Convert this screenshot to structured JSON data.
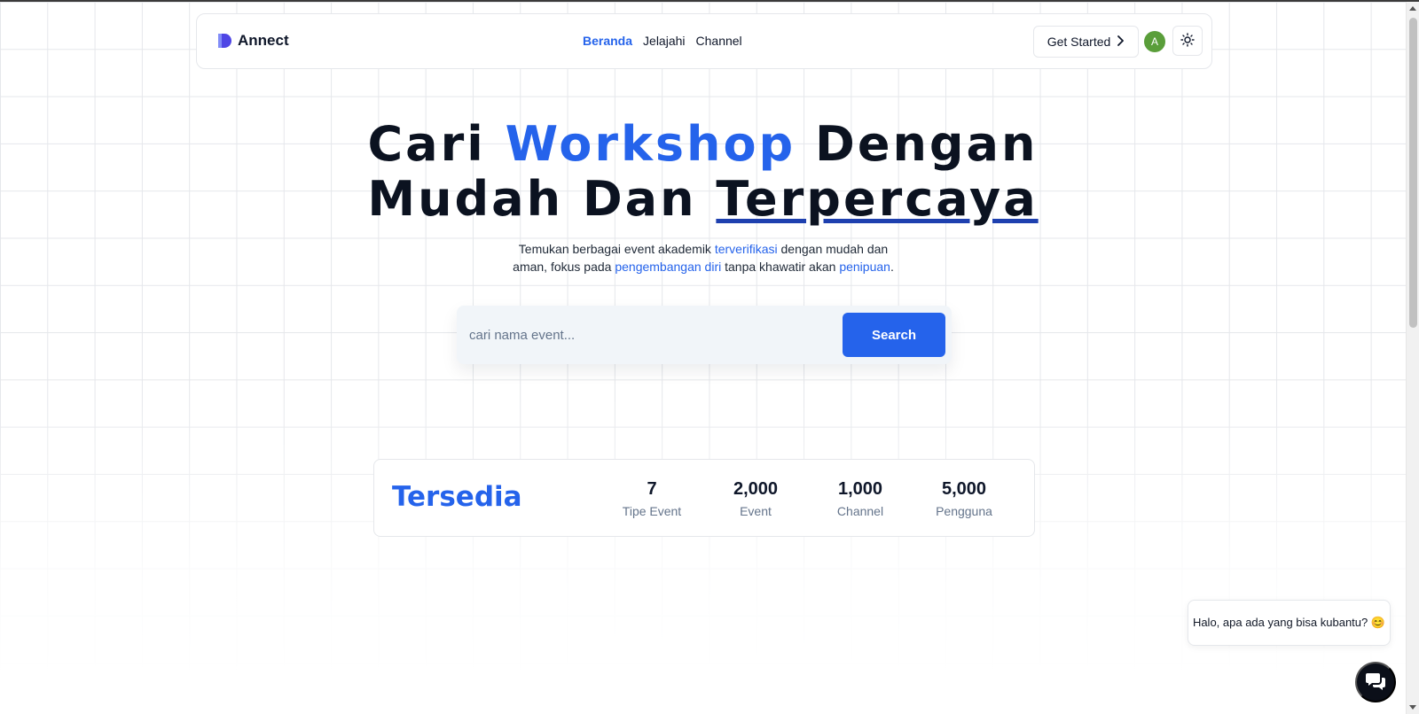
{
  "navbar": {
    "brand": "Annect",
    "links": [
      {
        "label": "Beranda",
        "active": true
      },
      {
        "label": "Jelajahi",
        "active": false
      },
      {
        "label": "Channel",
        "active": false
      }
    ],
    "get_started": "Get Started",
    "avatar_initial": "A",
    "theme_icon": "sun-icon"
  },
  "hero": {
    "title_part1": "Cari",
    "title_highlight": "Workshop",
    "title_part2": "Dengan",
    "title_line2_a": "Mudah Dan",
    "title_line2_underlined": "Terpercaya",
    "subtitle": {
      "t1": "Temukan berbagai event akademik",
      "h1": "terverifikasi",
      "t2": "dengan mudah dan aman, fokus pada",
      "h2": "pengembangan diri",
      "t3": "tanpa khawatir akan",
      "h3": "penipuan",
      "t4": "."
    }
  },
  "search": {
    "placeholder": "cari nama event...",
    "button": "Search"
  },
  "stats": {
    "title": "Tersedia",
    "items": [
      {
        "value": "7",
        "label": "Tipe Event"
      },
      {
        "value": "2,000",
        "label": "Event"
      },
      {
        "value": "1,000",
        "label": "Channel"
      },
      {
        "value": "5,000",
        "label": "Pengguna"
      }
    ]
  },
  "chat": {
    "greeting": "Halo, apa ada yang bisa kubantu? 😊",
    "button_icon": "chat-icon"
  },
  "colors": {
    "accent": "#2563eb",
    "underline": "#1e40af",
    "avatar": "#5a9e3a",
    "dark": "#0b1220"
  }
}
